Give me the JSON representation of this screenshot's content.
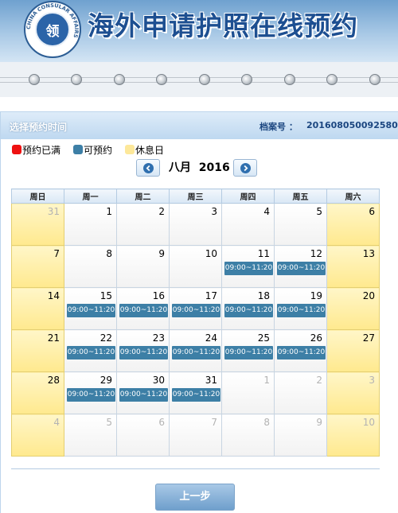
{
  "header": {
    "title": "海外申请护照在线预约",
    "logo_char": "领",
    "logo_ring_text": "CHINA CONSULAR AFFAIRS"
  },
  "progress": {
    "steps": 10
  },
  "panel": {
    "title": "选择预约时间",
    "file_no_label": "档案号 ：",
    "file_no": "201608050092580"
  },
  "legend": [
    {
      "label": "预约已满",
      "color": "#ee1111"
    },
    {
      "label": "可预约",
      "color": "#3d7fa6"
    },
    {
      "label": "休息日",
      "color": "#fde89a"
    }
  ],
  "month_nav": {
    "prev_icon": "chevron-left-icon",
    "next_icon": "chevron-right-icon",
    "month": "八月",
    "year": "2016"
  },
  "calendar": {
    "weekdays": [
      "周日",
      "周一",
      "周二",
      "周三",
      "周四",
      "周五",
      "周六"
    ],
    "weeks": [
      [
        {
          "day": "31",
          "other": true
        },
        {
          "day": "1"
        },
        {
          "day": "2"
        },
        {
          "day": "3"
        },
        {
          "day": "4"
        },
        {
          "day": "5"
        },
        {
          "day": "6"
        }
      ],
      [
        {
          "day": "7"
        },
        {
          "day": "8"
        },
        {
          "day": "9"
        },
        {
          "day": "10"
        },
        {
          "day": "11",
          "slot": "09:00~11:20"
        },
        {
          "day": "12",
          "slot": "09:00~11:20"
        },
        {
          "day": "13"
        }
      ],
      [
        {
          "day": "14"
        },
        {
          "day": "15",
          "slot": "09:00~11:20"
        },
        {
          "day": "16",
          "slot": "09:00~11:20"
        },
        {
          "day": "17",
          "slot": "09:00~11:20"
        },
        {
          "day": "18",
          "slot": "09:00~11:20"
        },
        {
          "day": "19",
          "slot": "09:00~11:20"
        },
        {
          "day": "20"
        }
      ],
      [
        {
          "day": "21"
        },
        {
          "day": "22",
          "slot": "09:00~11:20"
        },
        {
          "day": "23",
          "slot": "09:00~11:20"
        },
        {
          "day": "24",
          "slot": "09:00~11:20"
        },
        {
          "day": "25",
          "slot": "09:00~11:20"
        },
        {
          "day": "26",
          "slot": "09:00~11:20"
        },
        {
          "day": "27"
        }
      ],
      [
        {
          "day": "28"
        },
        {
          "day": "29",
          "slot": "09:00~11:20"
        },
        {
          "day": "30",
          "slot": "09:00~11:20"
        },
        {
          "day": "31",
          "slot": "09:00~11:20"
        },
        {
          "day": "1",
          "other": true
        },
        {
          "day": "2",
          "other": true
        },
        {
          "day": "3",
          "other": true
        }
      ],
      [
        {
          "day": "4",
          "other": true
        },
        {
          "day": "5",
          "other": true
        },
        {
          "day": "6",
          "other": true
        },
        {
          "day": "7",
          "other": true
        },
        {
          "day": "8",
          "other": true
        },
        {
          "day": "9",
          "other": true
        },
        {
          "day": "10",
          "other": true
        }
      ]
    ]
  },
  "buttons": {
    "prev_step": "上一步"
  }
}
